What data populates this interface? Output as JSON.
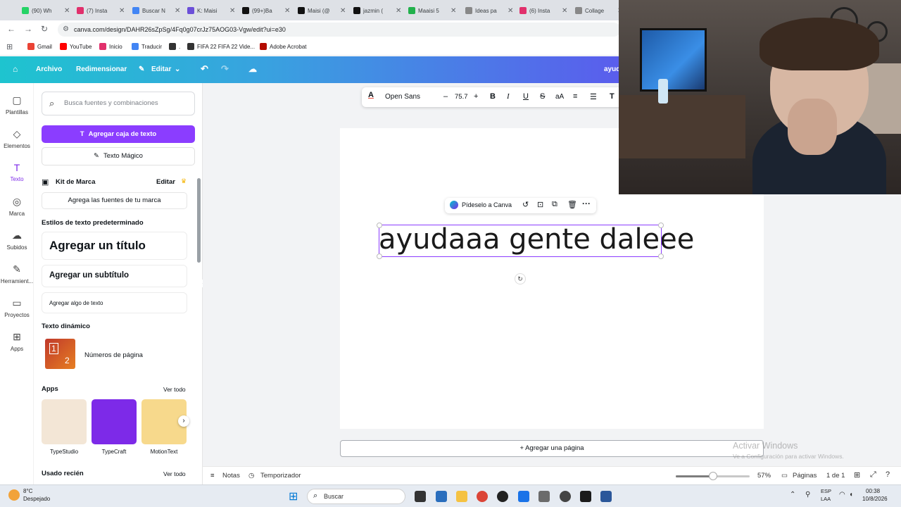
{
  "browser": {
    "tabs": [
      {
        "label": "(90) Wh",
        "color": "#25d366"
      },
      {
        "label": "(7) Insta",
        "color": "#e1306c"
      },
      {
        "label": "Buscar N",
        "color": "#4285f4"
      },
      {
        "label": "K: Maisi",
        "color": "#6b4fd8"
      },
      {
        "label": "(99+)Ba",
        "color": "#111111"
      },
      {
        "label": "Maisi (@",
        "color": "#111111"
      },
      {
        "label": "jazmin (",
        "color": "#111111"
      },
      {
        "label": "Maaisi 5",
        "color": "#22b14c"
      },
      {
        "label": "Ideas pa",
        "color": "#888888"
      },
      {
        "label": "(6) Insta",
        "color": "#e1306c"
      },
      {
        "label": "Collage",
        "color": "#888888"
      }
    ],
    "url": "canva.com/design/DAHR26sZpSg/4Fq0g07crJz75AOG03-Vgw/edit?ui=e30",
    "bookmarks": [
      {
        "label": "Gmail",
        "color": "#ea4335"
      },
      {
        "label": "YouTube",
        "color": "#ff0000"
      },
      {
        "label": "Inicio",
        "color": "#e1306c"
      },
      {
        "label": "Traducir",
        "color": "#4285f4"
      },
      {
        "label": ".",
        "color": "#333333"
      },
      {
        "label": "FIFA 22 FIFA 22 Vide...",
        "color": "#333333"
      },
      {
        "label": "Adobe Acrobat",
        "color": "#b30b00"
      }
    ]
  },
  "header": {
    "archivo": "Archivo",
    "redimensionar": "Redimensionar",
    "editar": "Editar",
    "user_partial": "ayud"
  },
  "rail": {
    "items": [
      {
        "label": "Plantillas",
        "icon": "▢"
      },
      {
        "label": "Elementos",
        "icon": "◇"
      },
      {
        "label": "Texto",
        "icon": "T"
      },
      {
        "label": "Marca",
        "icon": "◎"
      },
      {
        "label": "Subidos",
        "icon": "☁"
      },
      {
        "label": "Herramient...",
        "icon": "✎"
      },
      {
        "label": "Proyectos",
        "icon": "▭"
      },
      {
        "label": "Apps",
        "icon": "⊞"
      }
    ]
  },
  "panel": {
    "search_placeholder": "Busca fuentes y combinaciones",
    "add_text_box": "Agregar caja de texto",
    "magic_text": "Texto Mágico",
    "brand_kit": "Kit de Marca",
    "brand_kit_edit": "Editar",
    "brand_fonts": "Agrega las fuentes de tu marca",
    "default_styles": "Estilos de texto predeterminado",
    "add_title": "Agregar un título",
    "add_subtitle": "Agregar un subtítulo",
    "add_body": "Agregar algo de texto",
    "dynamic_text": "Texto dinámico",
    "page_numbers": "Números de página",
    "apps": "Apps",
    "see_all": "Ver todo",
    "app_items": [
      {
        "label": "TypeStudio",
        "color": "#f3e6d6"
      },
      {
        "label": "TypeCraft",
        "color": "#7d2ae8"
      },
      {
        "label": "MotionText",
        "color": "#f7d98c"
      }
    ],
    "recent": "Usado recién",
    "recent_see_all": "Ver todo"
  },
  "toolbar": {
    "font": "Open Sans",
    "size": "75.7",
    "minus": "–",
    "plus": "+"
  },
  "canvas": {
    "text": "ayudaaa gente  daleee",
    "ask_canva": "Pídeselo a Canva",
    "add_page": "+ Agregar una página"
  },
  "bottom": {
    "notes": "Notas",
    "timer": "Temporizador",
    "zoom": "57%",
    "pages": "Páginas",
    "page_count": "1 de 1",
    "zoom_level": 0.5,
    "watermark_title": "Activar Windows",
    "watermark_sub": "Ve a Configuración para activar Windows."
  },
  "taskbar": {
    "weather_temp": "8°C",
    "weather_desc": "Despejado",
    "search": "Buscar",
    "lang1": "ESP",
    "lang2": "LAA",
    "time": "00:38",
    "date": "10/8/2026"
  }
}
